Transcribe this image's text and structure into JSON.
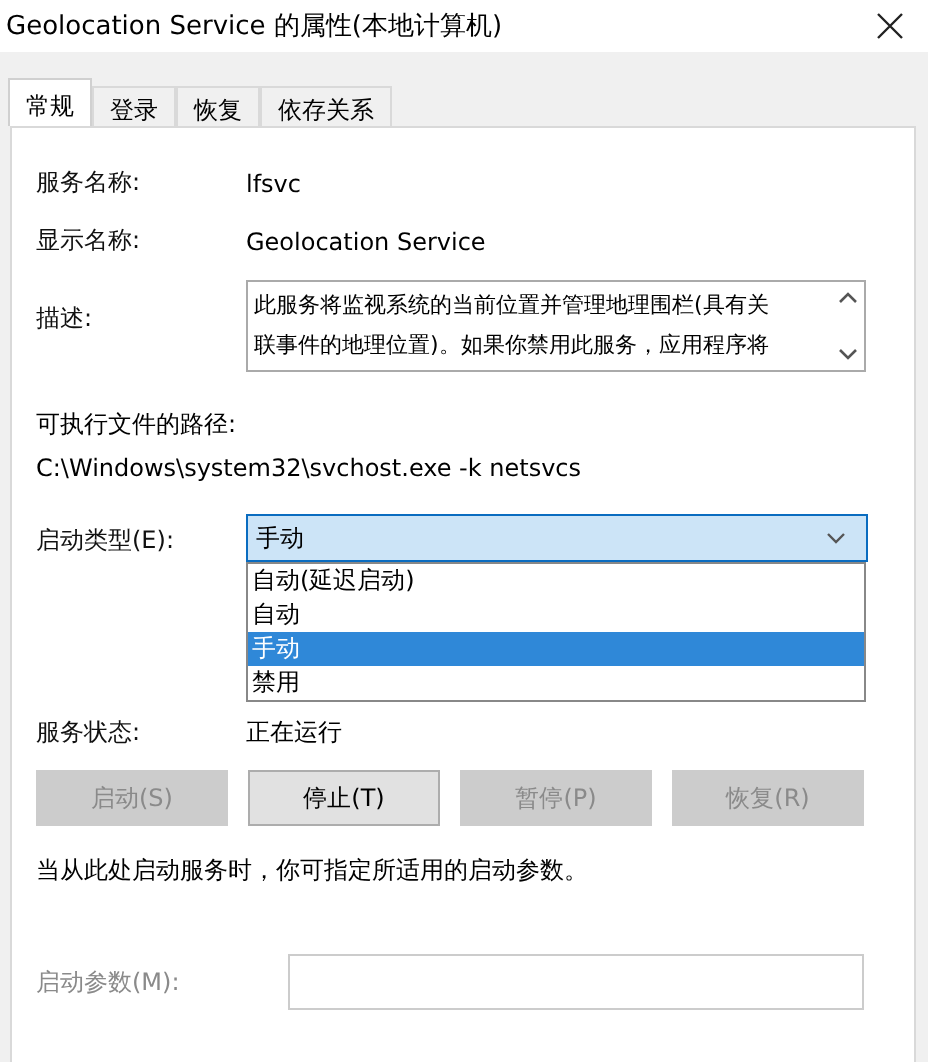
{
  "window": {
    "title": "Geolocation Service 的属性(本地计算机)"
  },
  "tabs": [
    {
      "label": "常规",
      "selected": true
    },
    {
      "label": "登录",
      "selected": false
    },
    {
      "label": "恢复",
      "selected": false
    },
    {
      "label": "依存关系",
      "selected": false
    }
  ],
  "fields": [
    {
      "label": "服务名称:",
      "value": "lfsvc"
    },
    {
      "label": "显示名称:",
      "value": "Geolocation Service"
    }
  ],
  "description": {
    "label": "描述:",
    "lines": [
      "此服务将监视系统的当前位置并管理地理围栏(具有关",
      "联事件的地理位置)。如果你禁用此服务，应用程序将"
    ]
  },
  "path": {
    "label": "可执行文件的路径:",
    "value": "C:\\Windows\\system32\\svchost.exe -k netsvcs"
  },
  "startup_type": {
    "label": "启动类型(E):",
    "value": "手动",
    "expanded": true,
    "options": [
      {
        "label": "自动(延迟启动)",
        "selected": false
      },
      {
        "label": "自动",
        "selected": false
      },
      {
        "label": "手动",
        "selected": true
      },
      {
        "label": "禁用",
        "selected": false
      }
    ]
  },
  "service_status": {
    "label": "服务状态:",
    "value": "正在运行"
  },
  "buttons": [
    {
      "label": "启动(S)",
      "disabled": true
    },
    {
      "label": "停止(T)",
      "disabled": false
    },
    {
      "label": "暂停(P)",
      "disabled": true
    },
    {
      "label": "恢复(R)",
      "disabled": true
    }
  ],
  "hint": "当从此处启动服务时，你可指定所适用的启动参数。",
  "start_parameters": {
    "label": "启动参数(M):",
    "disabled": true
  }
}
